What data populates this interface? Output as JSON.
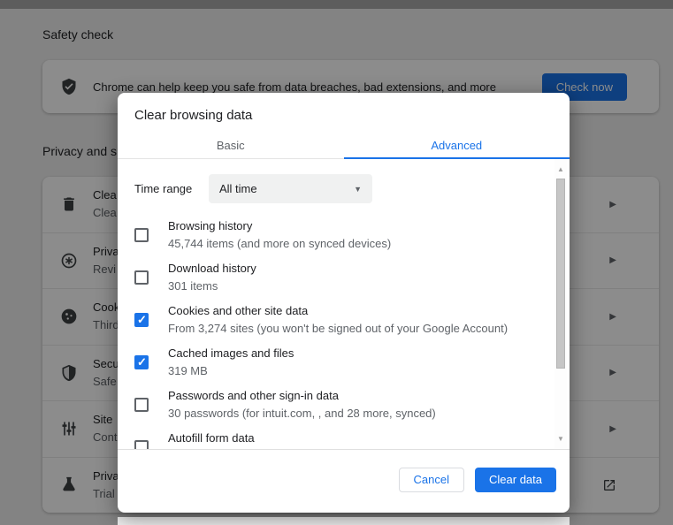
{
  "page": {
    "safety_heading": "Safety check",
    "privacy_heading_fragment": "Privacy and s",
    "banner": {
      "icon": "shield-check-icon",
      "text": "Chrome can help keep you safe from data breaches, bad extensions, and more",
      "button_label": "Check now"
    },
    "rows": [
      {
        "icon": "trash-icon",
        "line1": "Clea",
        "line2": "Clea",
        "trailing": "chevron-right-icon"
      },
      {
        "icon": "privacy-guide-icon",
        "line1": "Priva",
        "line2": "Revi",
        "trailing": "chevron-right-icon"
      },
      {
        "icon": "cookie-icon",
        "line1": "Cook",
        "line2": "Third",
        "trailing": "chevron-right-icon"
      },
      {
        "icon": "security-shield-icon",
        "line1": "Secu",
        "line2": "Safe",
        "trailing": "chevron-right-icon"
      },
      {
        "icon": "site-settings-icon",
        "line1": "Site",
        "line2": "Cont",
        "trailing": "chevron-right-icon"
      },
      {
        "icon": "flask-icon",
        "line1": "Priva",
        "line2": "Trial",
        "trailing": "open-in-new-icon"
      }
    ]
  },
  "dialog": {
    "title": "Clear browsing data",
    "tabs": [
      {
        "label": "Basic",
        "active": false
      },
      {
        "label": "Advanced",
        "active": true
      }
    ],
    "time_range": {
      "label": "Time range",
      "value": "All time"
    },
    "items": [
      {
        "label": "Browsing history",
        "detail": "45,744 items (and more on synced devices)",
        "checked": false
      },
      {
        "label": "Download history",
        "detail": "301 items",
        "checked": false
      },
      {
        "label": "Cookies and other site data",
        "detail": "From 3,274 sites (you won't be signed out of your Google Account)",
        "checked": true
      },
      {
        "label": "Cached images and files",
        "detail": "319 MB",
        "checked": true
      },
      {
        "label": "Passwords and other sign-in data",
        "detail": "30 passwords (for intuit.com, , and 28 more, synced)",
        "checked": false
      },
      {
        "label": "Autofill form data",
        "detail": "",
        "checked": false
      }
    ],
    "buttons": {
      "cancel": "Cancel",
      "confirm": "Clear data"
    }
  },
  "colors": {
    "accent": "#1a73e8",
    "title_text": "#202124",
    "secondary_text": "#5f6368"
  }
}
